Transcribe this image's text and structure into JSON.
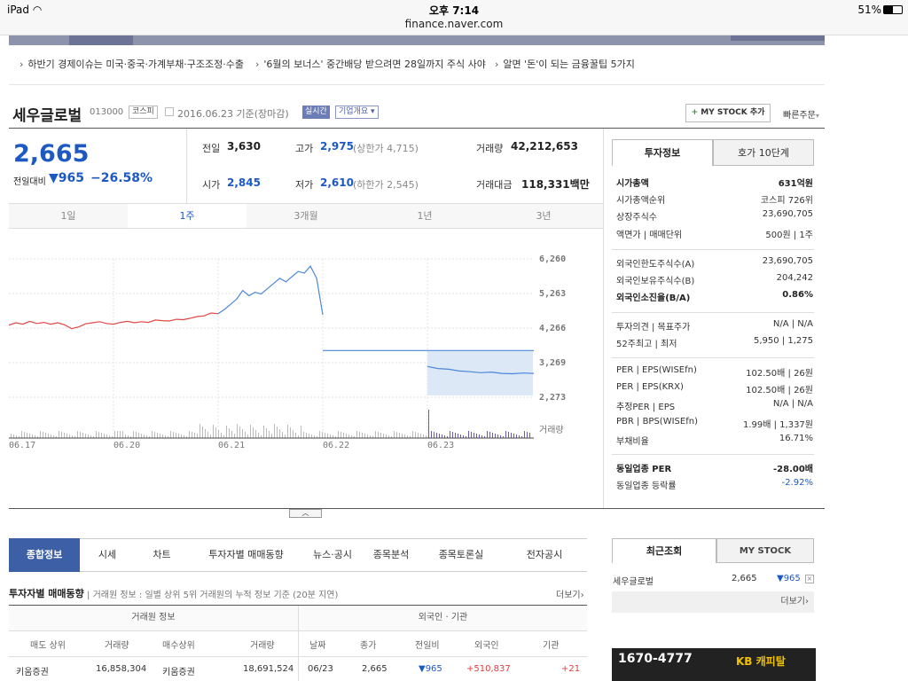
{
  "status_bar": {
    "device": "iPad",
    "time": "오후 7:14",
    "url": "finance.naver.com",
    "battery": "51%"
  },
  "news": [
    "하반기 경제이슈는 미국·중국·가계부채·구조조정·수출",
    "'6월의 보너스' 중간배당 받으려면 28일까지 주식 사야",
    "알면 '돈'이 되는 금융꿀팁 5가지"
  ],
  "stock": {
    "name": "세우글로벌",
    "code": "013000",
    "market": "코스피",
    "date": "2016.06.23 기준(장마감)",
    "realtime": "실시간",
    "overview": "기업개요",
    "add_mystock": "MY STOCK 추가",
    "quick_order": "빠른주문",
    "price": "2,665",
    "prev_label": "전일대비",
    "change": "▼965",
    "change_pct": "−26.58%"
  },
  "quote": {
    "prev_close": {
      "label": "전일",
      "value": "3,630"
    },
    "high": {
      "label": "고가",
      "value": "2,975",
      "extra": "(상한가 4,715)"
    },
    "volume": {
      "label": "거래량",
      "value": "42,212,653"
    },
    "open": {
      "label": "시가",
      "value": "2,845"
    },
    "low": {
      "label": "저가",
      "value": "2,610",
      "extra": "(하한가 2,545)"
    },
    "amount": {
      "label": "거래대금",
      "value": "118,331백만"
    }
  },
  "range_tabs": [
    "1일",
    "1주",
    "3개월",
    "1년",
    "3년"
  ],
  "chart_data": {
    "type": "line",
    "y_ticks": [
      "6,260",
      "5,263",
      "4,266",
      "3,269",
      "2,273"
    ],
    "ylim": [
      2273,
      6260
    ],
    "x_ticks": [
      "06.17",
      "06.20",
      "06.21",
      "06.22",
      "06.23"
    ],
    "volume_label": "거래량",
    "series": [
      {
        "values": [
          4350,
          4420,
          4380,
          4460,
          4400,
          4430,
          4380,
          4420,
          4360,
          4250,
          4300,
          4390,
          4420,
          4450,
          4400,
          4380,
          4430,
          4460,
          4420,
          4450,
          4430,
          4500,
          4480,
          4470,
          4520,
          4510,
          4550,
          4600,
          4620,
          4700,
          4680
        ]
      },
      {
        "values": [
          4680,
          4800,
          4950,
          5100,
          5350,
          5200,
          5300,
          5250,
          5400,
          5550,
          5700,
          5600,
          5750,
          5900,
          5850,
          6050,
          5700,
          4650
        ]
      },
      {
        "values": [
          3620,
          3620,
          3620,
          3620
        ]
      },
      {
        "values": [
          3160,
          3100,
          3080,
          3030,
          3010,
          2980,
          3000,
          2960,
          2950,
          2970,
          2960
        ]
      }
    ]
  },
  "tabs_right": {
    "invest": "투자정보",
    "hoga": "호가 10단계"
  },
  "invest": {
    "g1": [
      {
        "k": "시가총액",
        "v": "631억원",
        "bold": true
      },
      {
        "k": "시가총액순위",
        "v": "코스피 726위"
      },
      {
        "k": "상장주식수",
        "v": "23,690,705"
      },
      {
        "k": "액면가 | 매매단위",
        "v": "500원 | 1주"
      }
    ],
    "g2": [
      {
        "k": "외국인한도주식수(A)",
        "v": "23,690,705"
      },
      {
        "k": "외국인보유주식수(B)",
        "v": "204,242"
      },
      {
        "k": "외국인소진율(B/A)",
        "v": "0.86%",
        "bold": true
      }
    ],
    "g3": [
      {
        "k": "투자의견 | 목표주가",
        "v": "N/A | N/A"
      },
      {
        "k": "52주최고 | 최저",
        "v": "5,950 | 1,275"
      }
    ],
    "g4": [
      {
        "k": "PER | EPS(WISEfn)",
        "v": "102.50배 | 26원"
      },
      {
        "k": "PER | EPS(KRX)",
        "v": "102.50배 | 26원"
      },
      {
        "k": "추정PER | EPS",
        "v": "N/A | N/A"
      },
      {
        "k": "PBR | BPS(WISEfn)",
        "v": "1.99배 | 1,337원"
      },
      {
        "k": "부채비율",
        "v": "16.71%"
      }
    ],
    "g5": [
      {
        "k": "동일업종 PER",
        "v": "-28.00배",
        "bold": true
      },
      {
        "k": "동일업종 등락률",
        "v": "-2.92%",
        "blue": true
      }
    ]
  },
  "bottom_tabs": [
    "종합정보",
    "시세",
    "차트",
    "투자자별 매매동향",
    "뉴스·공시",
    "종목분석",
    "종목토론실",
    "전자공시"
  ],
  "trade": {
    "title": "투자자별 매매동향",
    "desc": "거래원 정보 : 일별 상위 5위 거래원의 누적 정보 기준 (20분 지연)",
    "more": "더보기",
    "group1": "거래원 정보",
    "group2": "외국인 · 기관",
    "headers": [
      "매도 상위",
      "거래량",
      "매수상위",
      "거래량",
      "날짜",
      "종가",
      "전일비",
      "외국인",
      "기관"
    ],
    "row": [
      "키움증권",
      "16,858,304",
      "키움증권",
      "18,691,524",
      "06/23",
      "2,665",
      "▼965",
      "+510,837",
      "+21"
    ]
  },
  "recent": {
    "tab1": "최근조회",
    "tab2": "MY STOCK",
    "name": "세우글로벌",
    "price": "2,665",
    "change": "▼965",
    "more": "더보기"
  },
  "ad": {
    "phone": "1670-4777",
    "brand": "KB 캐피탈"
  }
}
